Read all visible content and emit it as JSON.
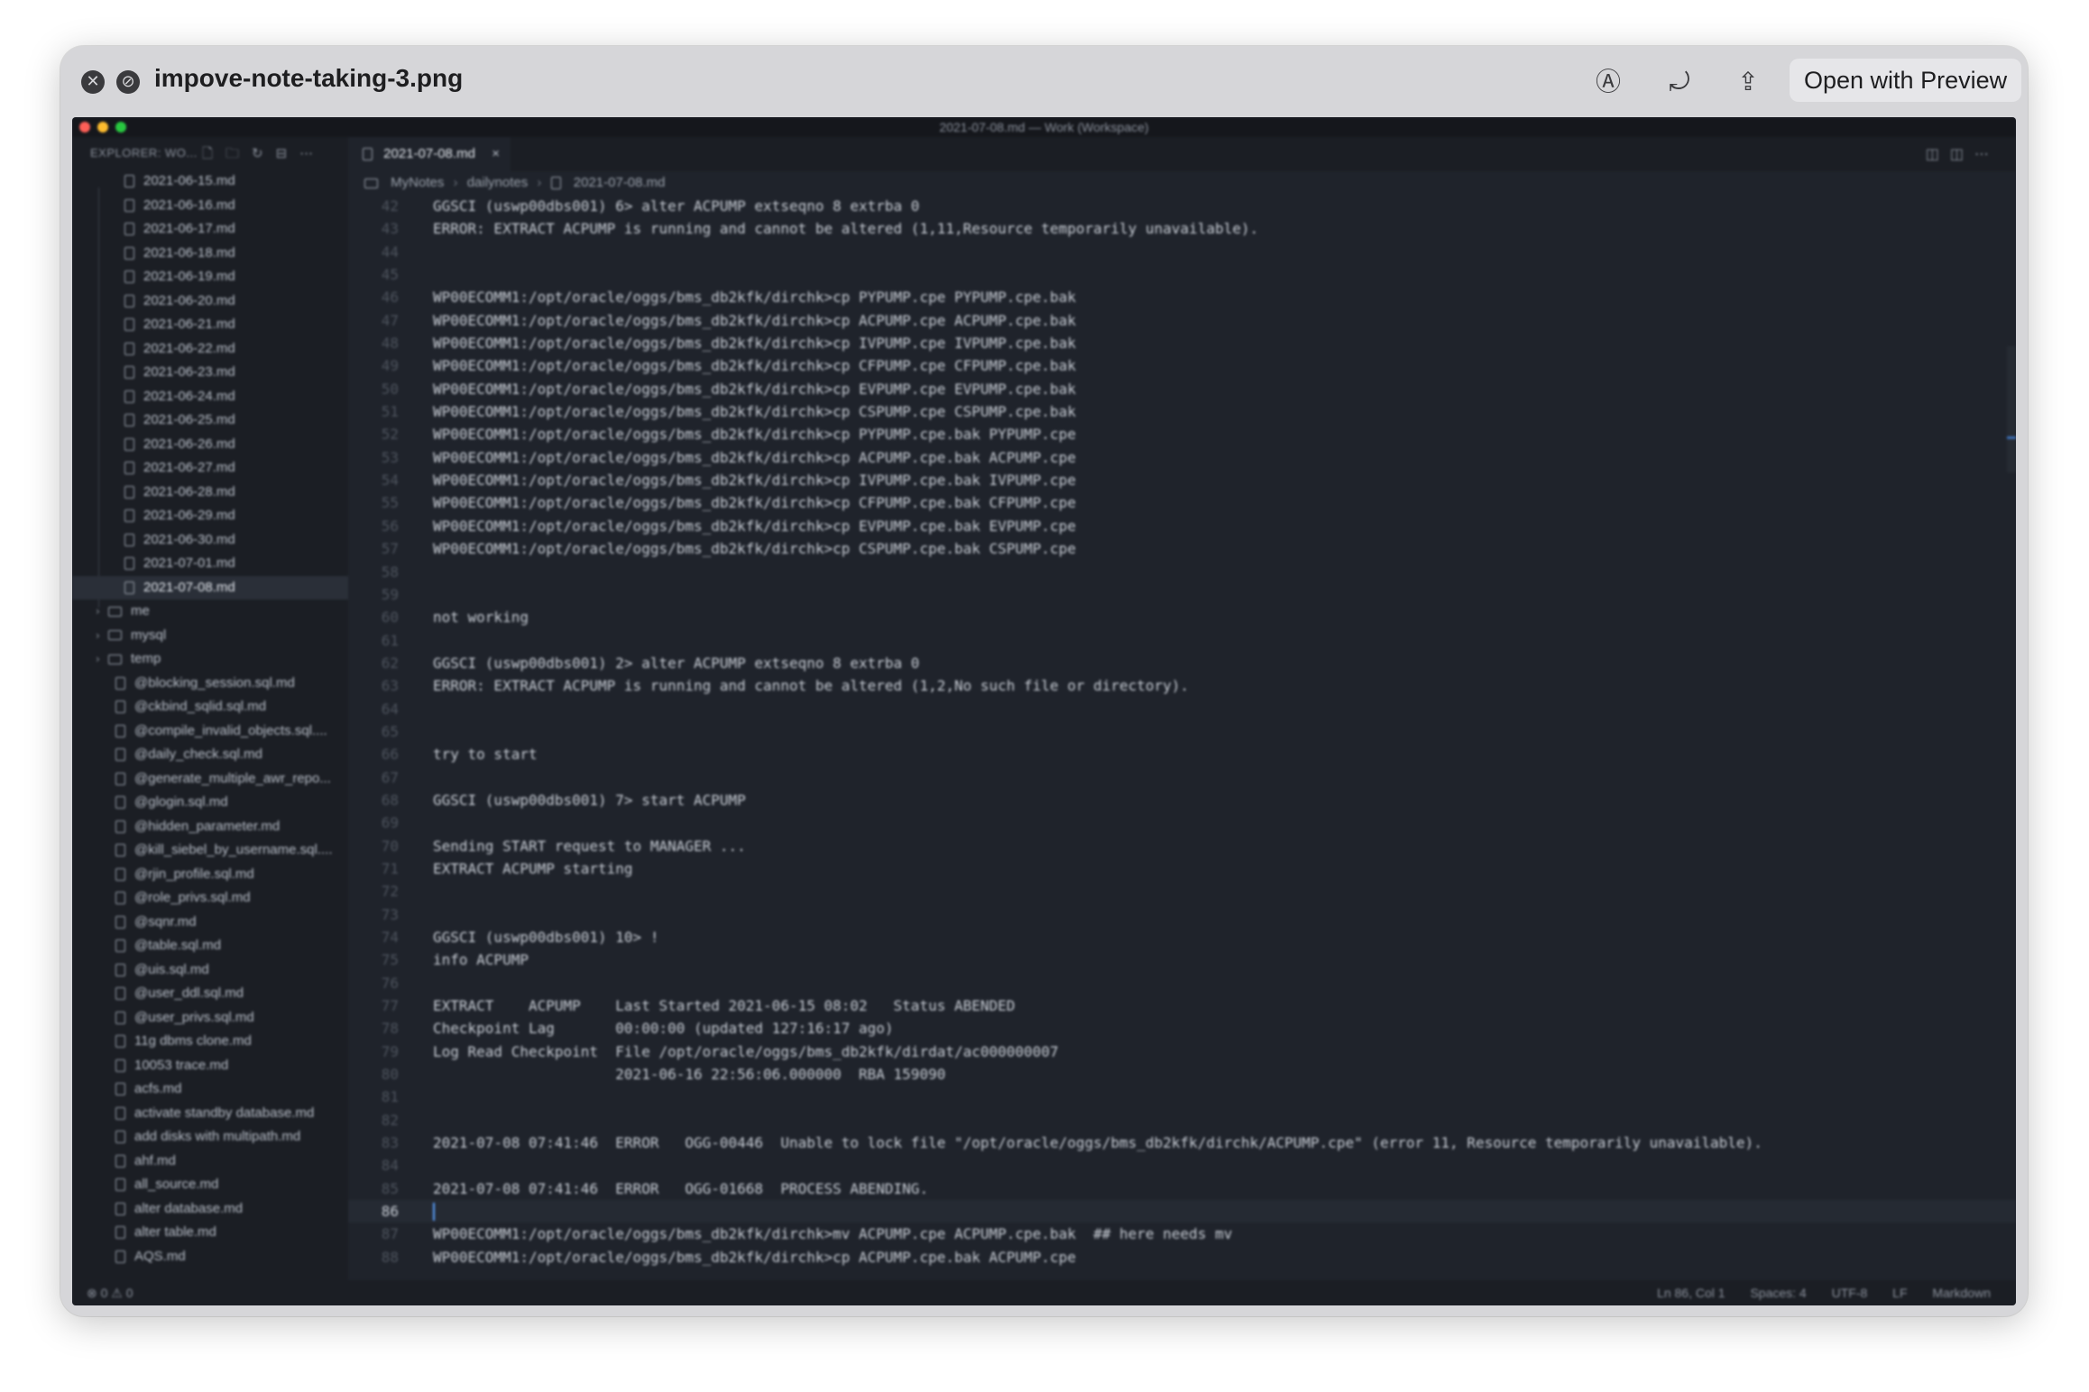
{
  "quicklook": {
    "title": "impove-note-taking-3.png",
    "open_button": "Open with Preview",
    "close_glyph": "✕",
    "fullscreen_glyph": "⊘",
    "markup_glyph": "Ⓐ",
    "rotate_glyph": "⤾",
    "share_glyph": "⇪"
  },
  "vscode": {
    "window_title": "2021-07-08.md — Work (Workspace)",
    "explorer_title": "EXPLORER: WO...",
    "explorer_icons": "🗋🗀↻⊟⋯",
    "tab": {
      "label": "2021-07-08.md",
      "close": "×"
    },
    "tab_actions": "◫◫⋯",
    "breadcrumb": [
      "MyNotes",
      "dailynotes",
      "2021-07-08.md"
    ],
    "breadcrumb_sep": "›",
    "tree": [
      {
        "label": "2021-06-15.md",
        "type": "file",
        "indent": 1
      },
      {
        "label": "2021-06-16.md",
        "type": "file",
        "indent": 1
      },
      {
        "label": "2021-06-17.md",
        "type": "file",
        "indent": 1
      },
      {
        "label": "2021-06-18.md",
        "type": "file",
        "indent": 1
      },
      {
        "label": "2021-06-19.md",
        "type": "file",
        "indent": 1
      },
      {
        "label": "2021-06-20.md",
        "type": "file",
        "indent": 1
      },
      {
        "label": "2021-06-21.md",
        "type": "file",
        "indent": 1
      },
      {
        "label": "2021-06-22.md",
        "type": "file",
        "indent": 1
      },
      {
        "label": "2021-06-23.md",
        "type": "file",
        "indent": 1
      },
      {
        "label": "2021-06-24.md",
        "type": "file",
        "indent": 1
      },
      {
        "label": "2021-06-25.md",
        "type": "file",
        "indent": 1
      },
      {
        "label": "2021-06-26.md",
        "type": "file",
        "indent": 1
      },
      {
        "label": "2021-06-27.md",
        "type": "file",
        "indent": 1
      },
      {
        "label": "2021-06-28.md",
        "type": "file",
        "indent": 1
      },
      {
        "label": "2021-06-29.md",
        "type": "file",
        "indent": 1
      },
      {
        "label": "2021-06-30.md",
        "type": "file",
        "indent": 1
      },
      {
        "label": "2021-07-01.md",
        "type": "file",
        "indent": 1
      },
      {
        "label": "2021-07-08.md",
        "type": "file",
        "indent": 1,
        "active": true
      },
      {
        "label": "me",
        "type": "folder",
        "indent": 0
      },
      {
        "label": "mysql",
        "type": "folder",
        "indent": 0
      },
      {
        "label": "temp",
        "type": "folder",
        "indent": 0
      },
      {
        "label": "@blocking_session.sql.md",
        "type": "file",
        "indent": 0
      },
      {
        "label": "@ckbind_sqlid.sql.md",
        "type": "file",
        "indent": 0
      },
      {
        "label": "@compile_invalid_objects.sql....",
        "type": "file",
        "indent": 0
      },
      {
        "label": "@daily_check.sql.md",
        "type": "file",
        "indent": 0
      },
      {
        "label": "@generate_multiple_awr_repo...",
        "type": "file",
        "indent": 0
      },
      {
        "label": "@glogin.sql.md",
        "type": "file",
        "indent": 0
      },
      {
        "label": "@hidden_parameter.md",
        "type": "file",
        "indent": 0
      },
      {
        "label": "@kill_siebel_by_username.sql....",
        "type": "file",
        "indent": 0
      },
      {
        "label": "@rjin_profile.sql.md",
        "type": "file",
        "indent": 0
      },
      {
        "label": "@role_privs.sql.md",
        "type": "file",
        "indent": 0
      },
      {
        "label": "@sqnr.md",
        "type": "file",
        "indent": 0
      },
      {
        "label": "@table.sql.md",
        "type": "file",
        "indent": 0
      },
      {
        "label": "@uis.sql.md",
        "type": "file",
        "indent": 0
      },
      {
        "label": "@user_ddl.sql.md",
        "type": "file",
        "indent": 0
      },
      {
        "label": "@user_privs.sql.md",
        "type": "file",
        "indent": 0
      },
      {
        "label": "11g dbms clone.md",
        "type": "file",
        "indent": 0
      },
      {
        "label": "10053 trace.md",
        "type": "file",
        "indent": 0
      },
      {
        "label": "acfs.md",
        "type": "file",
        "indent": 0
      },
      {
        "label": "activate standby database.md",
        "type": "file",
        "indent": 0
      },
      {
        "label": "add disks with multipath.md",
        "type": "file",
        "indent": 0
      },
      {
        "label": "ahf.md",
        "type": "file",
        "indent": 0
      },
      {
        "label": "all_source.md",
        "type": "file",
        "indent": 0
      },
      {
        "label": "alter database.md",
        "type": "file",
        "indent": 0
      },
      {
        "label": "alter table.md",
        "type": "file",
        "indent": 0
      },
      {
        "label": "AQS.md",
        "type": "file",
        "indent": 0
      }
    ],
    "lines": [
      {
        "n": "42",
        "t": "GGSCI (uswp00dbs001) 6> alter ACPUMP extseqno 8 extrba 0"
      },
      {
        "n": "43",
        "t": "ERROR: EXTRACT ACPUMP is running and cannot be altered (1,11,Resource temporarily unavailable)."
      },
      {
        "n": "44",
        "t": ""
      },
      {
        "n": "45",
        "t": ""
      },
      {
        "n": "46",
        "t": "WP00ECOMM1:/opt/oracle/oggs/bms_db2kfk/dirchk>cp PYPUMP.cpe PYPUMP.cpe.bak"
      },
      {
        "n": "47",
        "t": "WP00ECOMM1:/opt/oracle/oggs/bms_db2kfk/dirchk>cp ACPUMP.cpe ACPUMP.cpe.bak"
      },
      {
        "n": "48",
        "t": "WP00ECOMM1:/opt/oracle/oggs/bms_db2kfk/dirchk>cp IVPUMP.cpe IVPUMP.cpe.bak"
      },
      {
        "n": "49",
        "t": "WP00ECOMM1:/opt/oracle/oggs/bms_db2kfk/dirchk>cp CFPUMP.cpe CFPUMP.cpe.bak"
      },
      {
        "n": "50",
        "t": "WP00ECOMM1:/opt/oracle/oggs/bms_db2kfk/dirchk>cp EVPUMP.cpe EVPUMP.cpe.bak"
      },
      {
        "n": "51",
        "t": "WP00ECOMM1:/opt/oracle/oggs/bms_db2kfk/dirchk>cp CSPUMP.cpe CSPUMP.cpe.bak"
      },
      {
        "n": "52",
        "t": "WP00ECOMM1:/opt/oracle/oggs/bms_db2kfk/dirchk>cp PYPUMP.cpe.bak PYPUMP.cpe"
      },
      {
        "n": "53",
        "t": "WP00ECOMM1:/opt/oracle/oggs/bms_db2kfk/dirchk>cp ACPUMP.cpe.bak ACPUMP.cpe"
      },
      {
        "n": "54",
        "t": "WP00ECOMM1:/opt/oracle/oggs/bms_db2kfk/dirchk>cp IVPUMP.cpe.bak IVPUMP.cpe"
      },
      {
        "n": "55",
        "t": "WP00ECOMM1:/opt/oracle/oggs/bms_db2kfk/dirchk>cp CFPUMP.cpe.bak CFPUMP.cpe"
      },
      {
        "n": "56",
        "t": "WP00ECOMM1:/opt/oracle/oggs/bms_db2kfk/dirchk>cp EVPUMP.cpe.bak EVPUMP.cpe"
      },
      {
        "n": "57",
        "t": "WP00ECOMM1:/opt/oracle/oggs/bms_db2kfk/dirchk>cp CSPUMP.cpe.bak CSPUMP.cpe"
      },
      {
        "n": "58",
        "t": ""
      },
      {
        "n": "59",
        "t": ""
      },
      {
        "n": "60",
        "t": "not working"
      },
      {
        "n": "61",
        "t": ""
      },
      {
        "n": "62",
        "t": "GGSCI (uswp00dbs001) 2> alter ACPUMP extseqno 8 extrba 0"
      },
      {
        "n": "63",
        "t": "ERROR: EXTRACT ACPUMP is running and cannot be altered (1,2,No such file or directory)."
      },
      {
        "n": "64",
        "t": ""
      },
      {
        "n": "65",
        "t": ""
      },
      {
        "n": "66",
        "t": "try to start"
      },
      {
        "n": "67",
        "t": ""
      },
      {
        "n": "68",
        "t": "GGSCI (uswp00dbs001) 7> start ACPUMP"
      },
      {
        "n": "69",
        "t": ""
      },
      {
        "n": "70",
        "t": "Sending START request to MANAGER ..."
      },
      {
        "n": "71",
        "t": "EXTRACT ACPUMP starting"
      },
      {
        "n": "72",
        "t": ""
      },
      {
        "n": "73",
        "t": ""
      },
      {
        "n": "74",
        "t": "GGSCI (uswp00dbs001) 10> !"
      },
      {
        "n": "75",
        "t": "info ACPUMP"
      },
      {
        "n": "76",
        "t": ""
      },
      {
        "n": "77",
        "t": "EXTRACT    ACPUMP    Last Started 2021-06-15 08:02   Status ABENDED"
      },
      {
        "n": "78",
        "t": "Checkpoint Lag       00:00:00 (updated 127:16:17 ago)"
      },
      {
        "n": "79",
        "t": "Log Read Checkpoint  File /opt/oracle/oggs/bms_db2kfk/dirdat/ac000000007"
      },
      {
        "n": "80",
        "t": "                     2021-06-16 22:56:06.000000  RBA 159090"
      },
      {
        "n": "81",
        "t": ""
      },
      {
        "n": "82",
        "t": ""
      },
      {
        "n": "83",
        "t": "2021-07-08 07:41:46  ERROR   OGG-00446  Unable to lock file \"/opt/oracle/oggs/bms_db2kfk/dirchk/ACPUMP.cpe\" (error 11, Resource temporarily unavailable)."
      },
      {
        "n": "84",
        "t": ""
      },
      {
        "n": "85",
        "t": "2021-07-08 07:41:46  ERROR   OGG-01668  PROCESS ABENDING."
      },
      {
        "n": "86",
        "t": "",
        "current": true
      },
      {
        "n": "87",
        "t": "WP00ECOMM1:/opt/oracle/oggs/bms_db2kfk/dirchk>mv ACPUMP.cpe ACPUMP.cpe.bak  ## here needs mv"
      },
      {
        "n": "88",
        "t": "WP00ECOMM1:/opt/oracle/oggs/bms_db2kfk/dirchk>cp ACPUMP.cpe.bak ACPUMP.cpe"
      }
    ],
    "status": {
      "problems": "⊗ 0 ⚠ 0",
      "position": "Ln 86, Col 1",
      "spaces": "Spaces: 4",
      "encoding": "UTF-8",
      "eol": "LF",
      "language": "Markdown"
    }
  }
}
